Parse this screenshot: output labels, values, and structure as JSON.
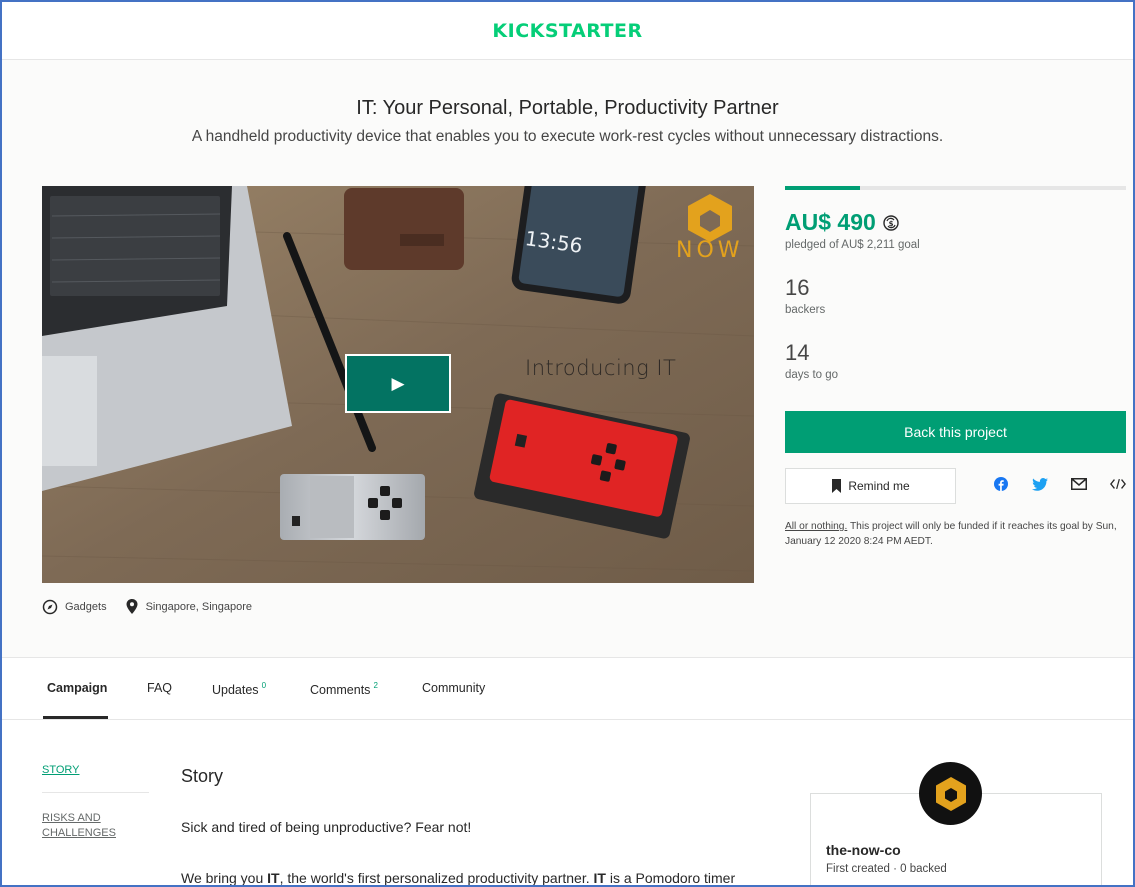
{
  "brand": {
    "logo": "KICKSTARTER",
    "accent": "#05ce78",
    "primary": "#009e74"
  },
  "project": {
    "title": "IT: Your Personal, Portable, Productivity Partner",
    "blurb": "A handheld productivity device that enables you to execute work-rest cycles without unnecessary distractions.",
    "video": {
      "overlay_text": "Introducing IT",
      "logo_text": "NOW",
      "play_label": "▶",
      "phone_time": "13:56"
    },
    "category": "Gadgets",
    "location": "Singapore, Singapore"
  },
  "funding": {
    "progress_fraction": 0.22,
    "pledged": "AU$ 490",
    "goal_text": "pledged of AU$ 2,211 goal",
    "backers": "16",
    "backers_label": "backers",
    "days": "14",
    "days_label": "days to go",
    "back_button": "Back this project",
    "remind_button": "Remind me",
    "aon_link": "All or nothing.",
    "aon_text": " This project will only be funded if it reaches its goal by Sun, January 12 2020 8:24 PM AEDT."
  },
  "share_icons": [
    "facebook-icon",
    "twitter-icon",
    "email-icon",
    "embed-icon"
  ],
  "tabs": [
    {
      "label": "Campaign",
      "count": ""
    },
    {
      "label": "FAQ",
      "count": ""
    },
    {
      "label": "Updates",
      "count": "0"
    },
    {
      "label": "Comments",
      "count": "2"
    },
    {
      "label": "Community",
      "count": ""
    }
  ],
  "sidebar": {
    "story": "STORY",
    "risks": "RISKS AND CHALLENGES"
  },
  "story": {
    "heading": "Story",
    "p1": "Sick and tired of being unproductive? Fear not!",
    "p2_pre": "We bring you ",
    "p2_b1": "IT",
    "p2_mid": ", the world's first personalized productivity partner. ",
    "p2_b2": "IT",
    "p2_post": " is a Pomodoro timer"
  },
  "creator": {
    "name": "the-now-co",
    "meta": "First created · 0 backed"
  }
}
